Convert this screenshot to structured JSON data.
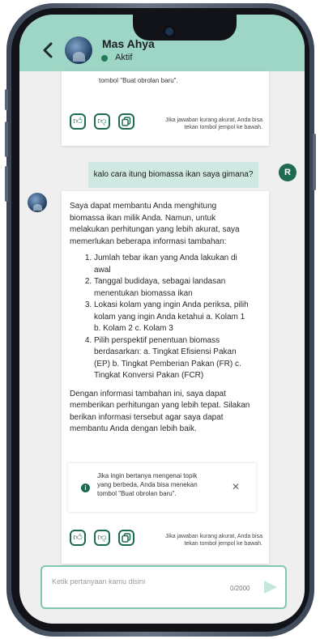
{
  "header": {
    "name": "Mas Ahya",
    "status": "Aktif",
    "status_color": "#1f7a55"
  },
  "top_card": {
    "text_tail": "tombol \"Buat obrolan baru\".",
    "feedback_note_l1": "Jika jawaban kurang akurat, Anda bisa",
    "feedback_note_l2": "tekan tombol jempol ke bawah."
  },
  "user_msg": {
    "text": "kalo cara itung biomassa ikan saya gimana?",
    "avatar_letter": "R"
  },
  "bot_msg": {
    "intro": "Saya dapat membantu Anda menghitung biomassa ikan milik Anda. Namun, untuk melakukan perhitungan yang lebih akurat, saya memerlukan beberapa informasi tambahan:",
    "steps": [
      "Jumlah tebar ikan yang Anda lakukan di awal",
      "Tanggal budidaya, sebagai landasan menentukan biomassa ikan",
      "Lokasi kolam yang ingin Anda periksa, pilih kolam yang ingin Anda ketahui a. Kolam 1 b. Kolam 2 c. Kolam 3",
      "Pilih perspektif penentuan biomass berdasarkan: a. Tingkat Efisiensi Pakan (EP) b. Tingkat Pemberian Pakan (FR) c. Tingkat Konversi Pakan (FCR)"
    ],
    "outro": "Dengan informasi tambahan ini, saya dapat memberikan perhitungan yang lebih tepat. Silakan berikan informasi tersebut agar saya dapat membantu Anda dengan lebih baik.",
    "info_l1": "Jika ingin bertanya mengenai topik",
    "info_l2": "yang berbeda, Anda bisa menekan",
    "info_l3": "tombol \"Buat obrolan baru\".",
    "feedback_note_l1": "Jika jawaban kurang akurat, Anda bisa",
    "feedback_note_l2": "tekan tombol jempol ke bawah."
  },
  "input": {
    "placeholder": "Ketik pertanyaan kamu disini",
    "counter": "0/2000"
  },
  "colors": {
    "accent": "#1f6b52",
    "header_bg": "#9ed6c5",
    "user_bubble": "#cfe9e2"
  },
  "icons": {
    "back": "chevron-left",
    "like": "thumbs-up",
    "dislike": "thumbs-down",
    "copy": "copy",
    "info": "info",
    "close": "close",
    "send": "send"
  }
}
